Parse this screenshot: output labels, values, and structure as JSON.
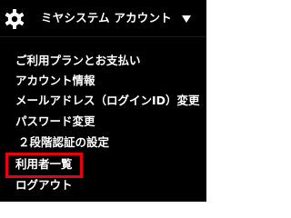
{
  "header": {
    "account_label": "ミヤシステム アカウント",
    "settings_icon": "gear-icon",
    "dropdown_icon": "caret-down-icon"
  },
  "menu": {
    "items": [
      {
        "label": "ご利用プランとお支払い"
      },
      {
        "label": "アカウント情報"
      },
      {
        "label": "メールアドレス（ログインID）変更"
      },
      {
        "label": "パスワード変更"
      },
      {
        "label": "２段階認証の設定"
      },
      {
        "label": "利用者一覧",
        "highlighted": true
      },
      {
        "label": "ログアウト"
      }
    ]
  },
  "colors": {
    "background": "#000000",
    "text": "#ffffff",
    "highlight_border": "#e60012"
  }
}
